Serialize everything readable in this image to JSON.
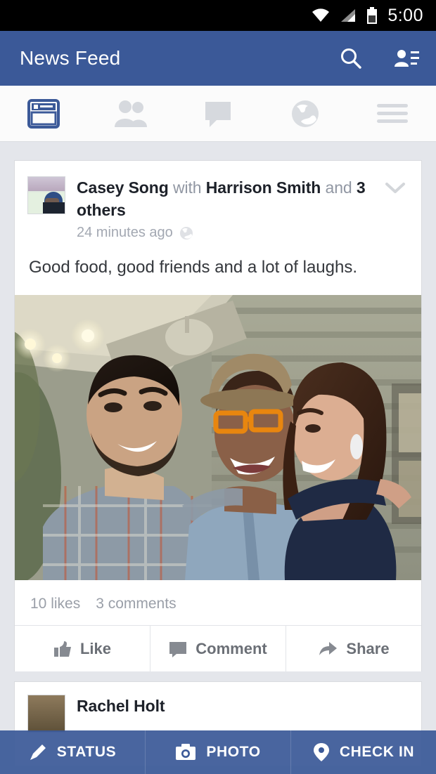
{
  "status_bar": {
    "time": "5:00",
    "icons": [
      "wifi-icon",
      "cellular-signal-icon",
      "battery-icon"
    ]
  },
  "header": {
    "title": "News Feed",
    "search_icon": "search-icon",
    "friend_requests_icon": "friend-requests-icon",
    "background_color": "#3b5998"
  },
  "tabs": [
    {
      "name": "news-feed",
      "icon": "news-feed-icon",
      "active": true
    },
    {
      "name": "friends",
      "icon": "friends-icon",
      "active": false
    },
    {
      "name": "messages",
      "icon": "messages-icon",
      "active": false
    },
    {
      "name": "notifications",
      "icon": "globe-icon",
      "active": false
    },
    {
      "name": "more",
      "icon": "hamburger-menu-icon",
      "active": false
    }
  ],
  "post": {
    "author": "Casey Song",
    "with_word": "with",
    "tagged": "Harrison Smith",
    "and_word": "and",
    "others": "3 others",
    "timestamp": "24 minutes ago",
    "privacy_icon": "globe-icon",
    "options_icon": "chevron-down-icon",
    "message": "Good food, good friends and a lot of laughs.",
    "likes": "10 likes",
    "comments": "3 comments",
    "actions": [
      {
        "label": "Like",
        "icon": "thumbs-up-icon"
      },
      {
        "label": "Comment",
        "icon": "comment-bubble-icon"
      },
      {
        "label": "Share",
        "icon": "share-arrow-icon"
      }
    ]
  },
  "next_post": {
    "author": "Rachel Holt"
  },
  "composer": {
    "buttons": [
      {
        "label": "STATUS",
        "icon": "pencil-icon"
      },
      {
        "label": "PHOTO",
        "icon": "camera-icon"
      },
      {
        "label": "CHECK IN",
        "icon": "location-pin-icon"
      }
    ]
  }
}
